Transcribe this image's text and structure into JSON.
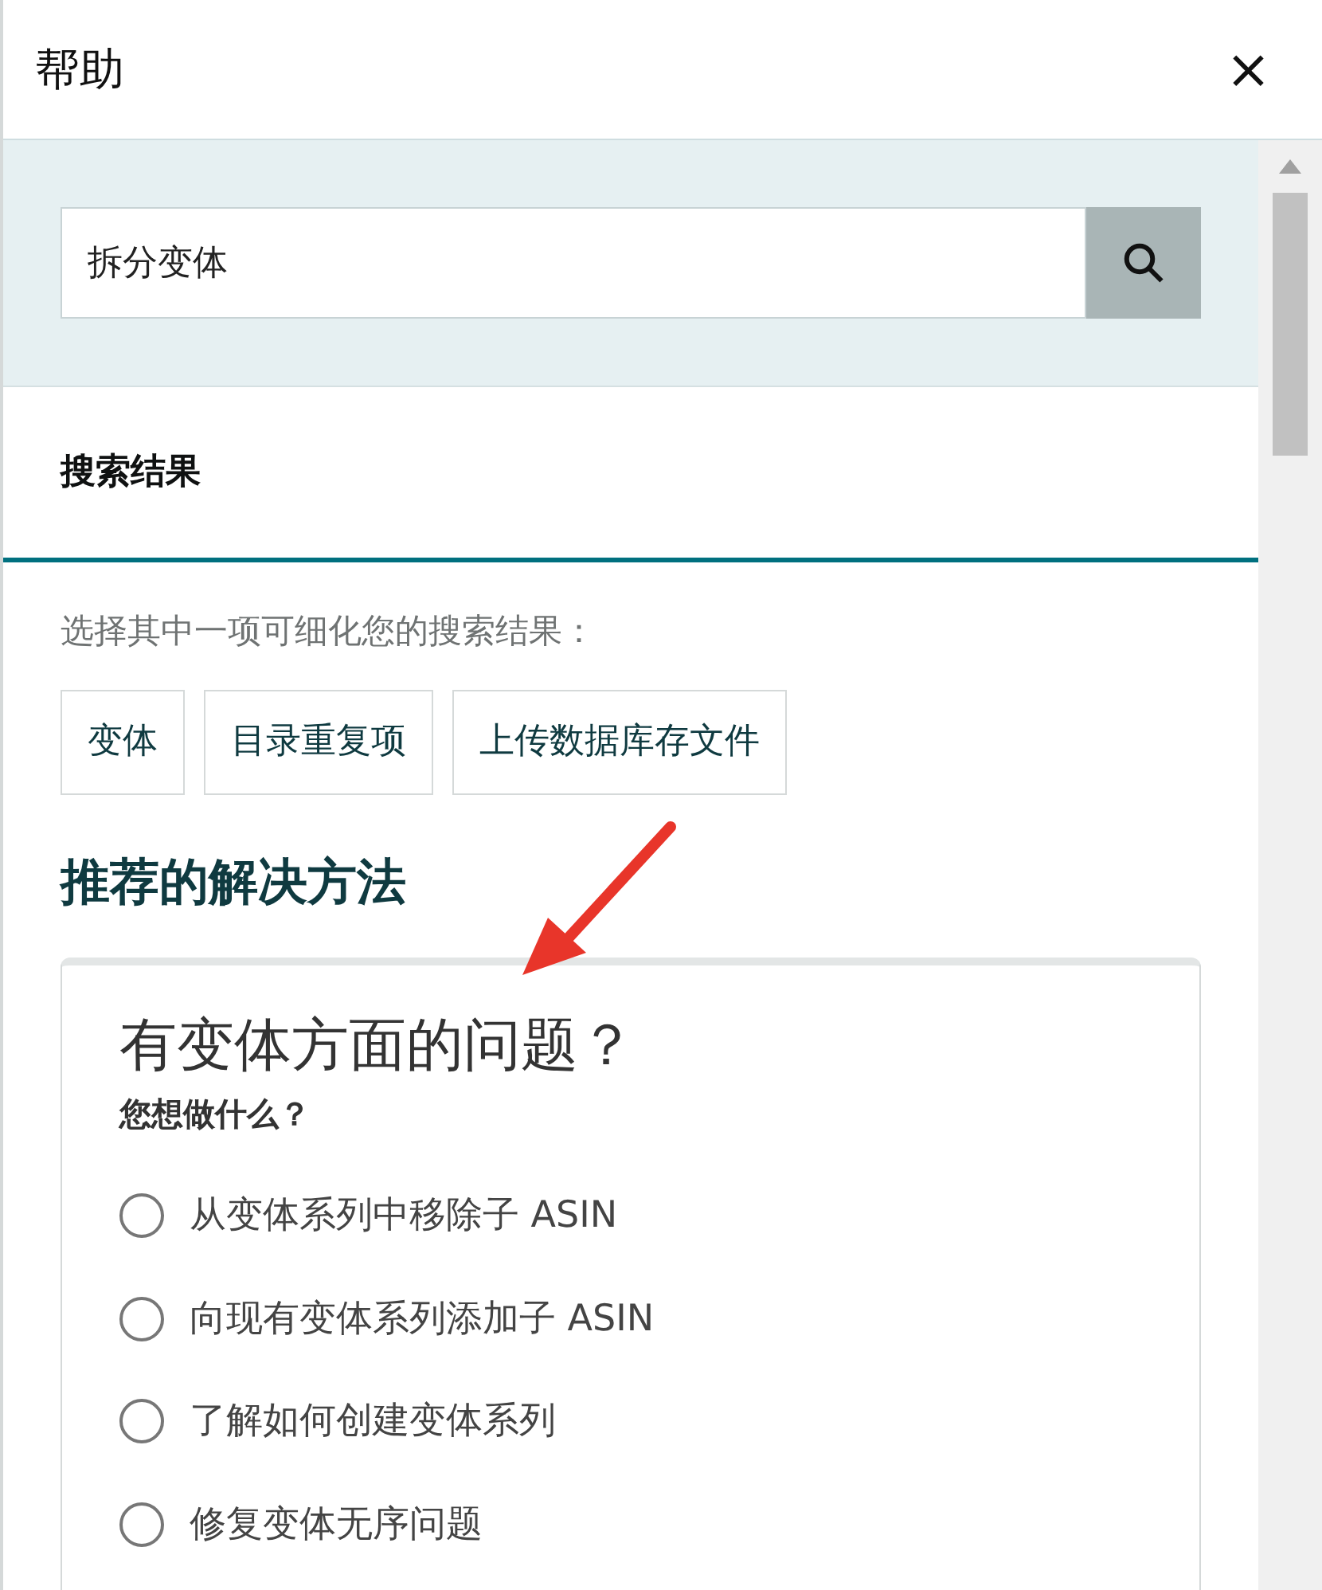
{
  "panel": {
    "title": "帮助",
    "close": "×"
  },
  "search": {
    "value": "拆分变体"
  },
  "results_tab": {
    "label": "搜索结果"
  },
  "refine": {
    "hint": "选择其中一项可细化您的搜索结果：",
    "chips": [
      "变体",
      "目录重复项",
      "上传数据库存文件"
    ]
  },
  "recommended": {
    "heading": "推荐的解决方法"
  },
  "card": {
    "title": "有变体方面的问题？",
    "question": "您想做什么？",
    "options": [
      {
        "label": "从变体系列中移除子 ASIN",
        "selected": false
      },
      {
        "label": "向现有变体系列添加子 ASIN",
        "selected": false
      },
      {
        "label": "了解如何创建变体系列",
        "selected": false
      },
      {
        "label": "修复变体无序问题",
        "selected": false
      }
    ]
  }
}
